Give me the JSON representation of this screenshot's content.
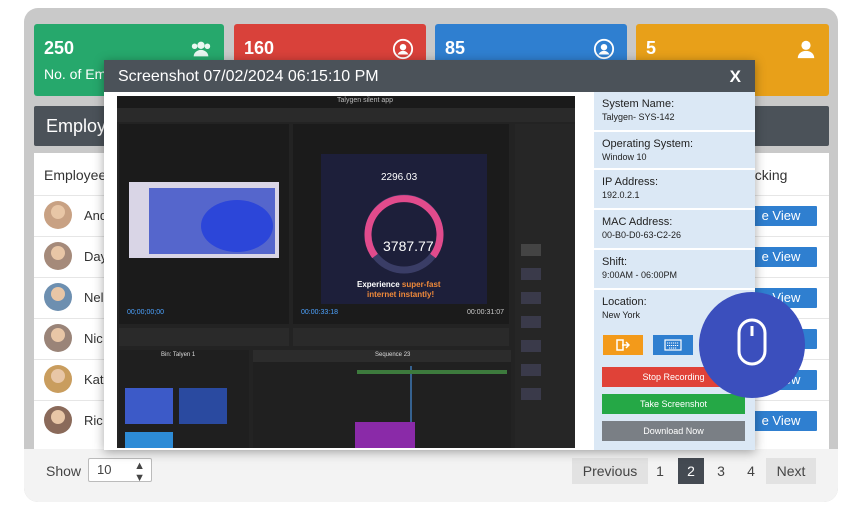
{
  "cards": [
    {
      "value": "250",
      "label": "No. of Em",
      "color": "#26a86c",
      "icon": "users-icon"
    },
    {
      "value": "160",
      "label": "",
      "color": "#d9413a",
      "icon": "user-circle-icon"
    },
    {
      "value": "85",
      "label": "",
      "color": "#2f7fd0",
      "icon": "user-circle-icon"
    },
    {
      "value": "5",
      "label": "",
      "color": "#e8a019",
      "icon": "user-icon"
    }
  ],
  "employees_bar": {
    "title": "Employ"
  },
  "table": {
    "header_left": "Employee",
    "header_right": "acking",
    "rows": [
      {
        "name": "And",
        "action": "e View"
      },
      {
        "name": "Day",
        "action": "e View"
      },
      {
        "name": "Nel",
        "action": "e View"
      },
      {
        "name": "Nic",
        "action": "e View"
      },
      {
        "name": "Kat",
        "action": "e View"
      },
      {
        "name": "Ric",
        "action": "e View"
      }
    ]
  },
  "footer": {
    "show_label": "Show",
    "page_size": "10",
    "previous": "Previous",
    "pages": [
      "1",
      "2",
      "3",
      "4"
    ],
    "active_page": "2",
    "next": "Next"
  },
  "modal": {
    "title": "Screenshot 07/02/2024 06:15:10 PM",
    "close": "X",
    "fields": [
      {
        "label": "System Name:",
        "value": "Talygen- SYS-142"
      },
      {
        "label": "Operating System:",
        "value": "Window 10"
      },
      {
        "label": "IP Address:",
        "value": "192.0.2.1"
      },
      {
        "label": "MAC Address:",
        "value": "00-B0-D0-63-C2-26"
      },
      {
        "label": "Shift:",
        "value": "9:00AM - 06:00PM"
      },
      {
        "label": "Location:",
        "value": "New York"
      }
    ],
    "stop_recording": "Stop Recording",
    "take_screenshot": "Take Screenshot",
    "download_now": "Download Now"
  },
  "screenshot_content": {
    "app_title": "Talygen silent app",
    "speed_value": "2296.03",
    "speed_main": "3787.77",
    "tagline_1": "Experience ",
    "tagline_accent": "super-fast",
    "tagline_2": "internet instantly!",
    "timecode_left": "00;00;00;00",
    "timecode_right": "00:00:33:18",
    "timecode_end": "00:00:31:07",
    "sequence_tab": "Sequence 23",
    "bin_label": "Bin: Talyen 1"
  }
}
